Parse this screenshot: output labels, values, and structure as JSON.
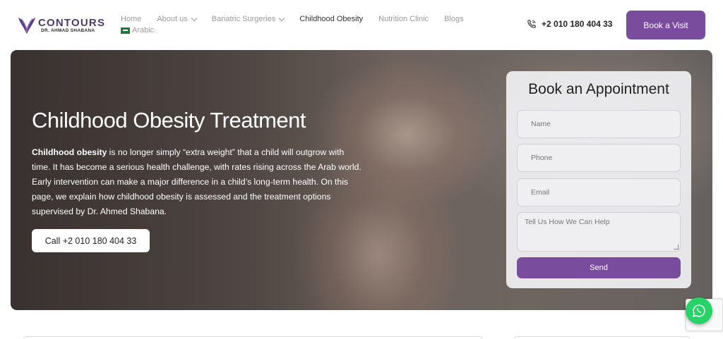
{
  "brand": {
    "name": "CONTOURS",
    "subtitle": "DR. AHMAD SHABANA"
  },
  "nav": {
    "items": [
      {
        "label": "Home"
      },
      {
        "label": "About us"
      },
      {
        "label": "Bariatric Surgeries"
      },
      {
        "label": "Childhood Obesity"
      },
      {
        "label": "Nutrition Clinic"
      },
      {
        "label": "Blogs"
      }
    ],
    "language": "Arabic"
  },
  "header": {
    "phone": "+2 010 180 404 33",
    "book_label": "Book a Visit"
  },
  "hero": {
    "title": "Childhood Obesity Treatment",
    "lead_bold": "Childhood obesity",
    "body": " is no longer simply “extra weight” that a child will outgrow with time. It has become a serious health challenge, with rates rising across the Arab world. Early intervention can make a major difference in a child’s long-term health. On this page, we explain how childhood obesity is assessed and the treatment options supervised by Dr. Ahmed Shabana.",
    "call_label": "Call +2 010 180 404 33"
  },
  "form": {
    "title": "Book an Appointment",
    "name_placeholder": "Name",
    "phone_placeholder": "Phone",
    "email_placeholder": "Email",
    "message_placeholder": "Tell Us How We Can Help",
    "send_label": "Send"
  },
  "colors": {
    "accent": "#7a4c9e",
    "whatsapp": "#25d366"
  }
}
